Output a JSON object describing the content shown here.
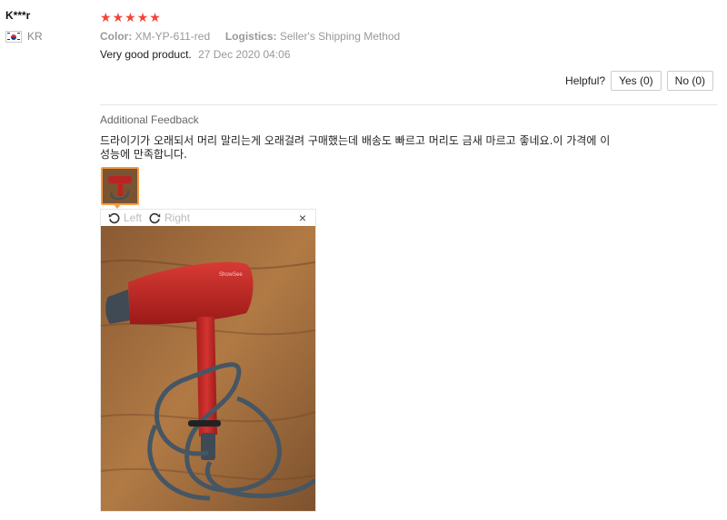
{
  "user": {
    "name": "K***r",
    "country": "KR"
  },
  "review": {
    "rating": 5,
    "color_label": "Color:",
    "color_value": "XM-YP-611-red",
    "logistics_label": "Logistics:",
    "logistics_value": "Seller's Shipping Method",
    "text": "Very good product.",
    "date": "27 Dec 2020 04:06"
  },
  "helpful": {
    "label": "Helpful?",
    "yes": "Yes (0)",
    "no": "No (0)"
  },
  "additional": {
    "title": "Additional Feedback",
    "text": "드라이기가 오래되서 머리 말리는게 오래걸려 구매했는데 배송도 빠르고 머리도 금새 마르고 좋네요.이 가격에 이 성능에 만족합니다."
  },
  "viewer": {
    "rotate_left": "Left",
    "rotate_right": "Right",
    "close": "×"
  },
  "colors": {
    "star": "#f44336",
    "thumb_border": "#f59b42",
    "dryer": "#c0221f"
  }
}
